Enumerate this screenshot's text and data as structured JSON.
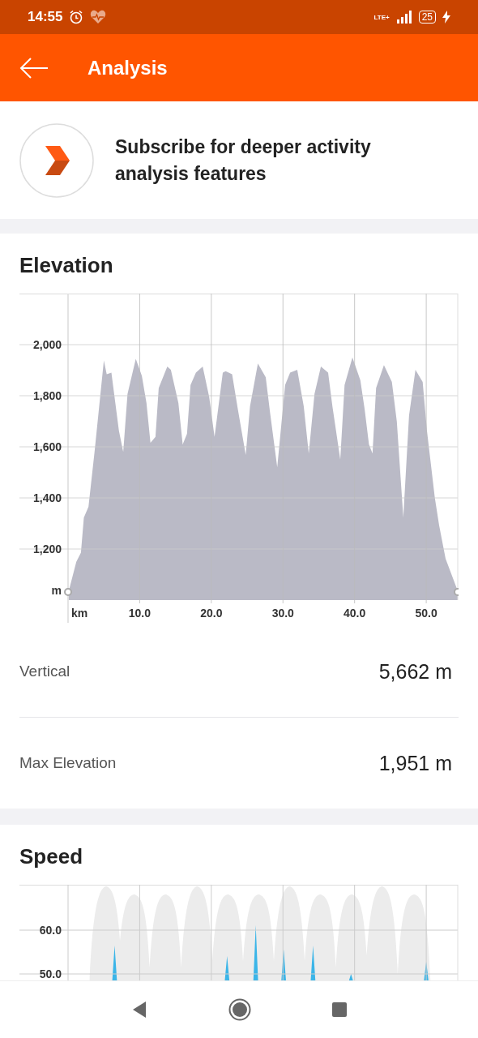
{
  "status_bar": {
    "time": "14:55",
    "network": "LTE+",
    "battery": "25"
  },
  "app_bar": {
    "title": "Analysis"
  },
  "promo": {
    "text": "Subscribe for deeper activity analysis features"
  },
  "elevation": {
    "chart_data": {
      "type": "area",
      "title": "Elevation",
      "xlabel": "km",
      "ylabel": "m",
      "xlim": [
        0,
        54.4
      ],
      "ylim": [
        1000,
        2200
      ],
      "grid": true,
      "xticks": [
        {
          "value": 10,
          "label": "10.0"
        },
        {
          "value": 20,
          "label": "20.0"
        },
        {
          "value": 30,
          "label": "30.0"
        },
        {
          "value": 40,
          "label": "40.0"
        },
        {
          "value": 50,
          "label": "50.0"
        }
      ],
      "yticks": [
        {
          "value": 1200,
          "label": "1,200"
        },
        {
          "value": 1400,
          "label": "1,400"
        },
        {
          "value": 1600,
          "label": "1,600"
        },
        {
          "value": 1800,
          "label": "1,800"
        },
        {
          "value": 2000,
          "label": "2,000"
        }
      ],
      "x": [
        0.1,
        1.15,
        1.8,
        2.2,
        2.85,
        3.7,
        5.0,
        5.4,
        6.05,
        7.1,
        7.7,
        8.3,
        9.45,
        10.3,
        10.95,
        11.5,
        12.2,
        12.65,
        13.85,
        14.35,
        15.4,
        16.0,
        16.6,
        17.1,
        17.85,
        18.8,
        19.7,
        20.45,
        21.6,
        22.0,
        22.9,
        23.7,
        24.8,
        25.4,
        26.5,
        27.6,
        28.2,
        29.2,
        30.3,
        31.0,
        32.0,
        32.9,
        33.6,
        34.4,
        35.3,
        36.3,
        36.9,
        38.0,
        38.6,
        39.7,
        40.8,
        41.4,
        42.0,
        42.5,
        43.0,
        44.1,
        45.2,
        45.9,
        46.8,
        47.6,
        48.5,
        49.5,
        50.1,
        51.2,
        51.8,
        52.7,
        54.4
      ],
      "series": [
        {
          "color": "#babac6",
          "values": [
            1036,
            1150,
            1186,
            1323,
            1365,
            1580,
            1938,
            1884,
            1890,
            1663,
            1580,
            1807,
            1944,
            1878,
            1771,
            1616,
            1639,
            1830,
            1914,
            1902,
            1771,
            1610,
            1651,
            1842,
            1890,
            1914,
            1795,
            1639,
            1890,
            1896,
            1884,
            1747,
            1568,
            1759,
            1926,
            1872,
            1735,
            1520,
            1842,
            1890,
            1902,
            1759,
            1574,
            1807,
            1914,
            1890,
            1759,
            1550,
            1842,
            1950,
            1860,
            1747,
            1610,
            1574,
            1830,
            1920,
            1854,
            1699,
            1323,
            1723,
            1902,
            1854,
            1663,
            1401,
            1293,
            1162,
            1036
          ]
        }
      ]
    },
    "stats": [
      {
        "label": "Vertical",
        "value": "5,662 m"
      },
      {
        "label": "Max Elevation",
        "value": "1,951 m"
      }
    ]
  },
  "speed": {
    "title": "Speed",
    "tick_labels": [
      "60.0",
      "50.0"
    ]
  }
}
